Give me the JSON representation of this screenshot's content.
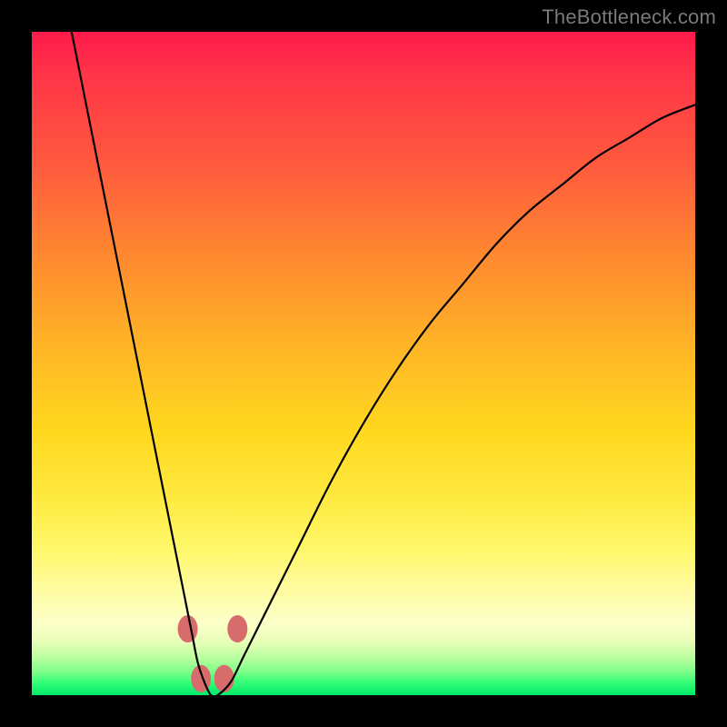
{
  "watermark": "TheBottleneck.com",
  "chart_data": {
    "type": "line",
    "title": "",
    "xlabel": "",
    "ylabel": "",
    "xlim": [
      0,
      100
    ],
    "ylim": [
      0,
      100
    ],
    "series": [
      {
        "name": "bottleneck-curve",
        "x": [
          6,
          8,
          10,
          12,
          14,
          16,
          18,
          20,
          22,
          24,
          25,
          26,
          27,
          28,
          30,
          32,
          35,
          40,
          45,
          50,
          55,
          60,
          65,
          70,
          75,
          80,
          85,
          90,
          95,
          100
        ],
        "y": [
          100,
          90,
          80,
          70,
          60,
          50,
          40,
          30,
          20,
          10,
          5,
          2,
          0,
          0,
          2,
          6,
          12,
          22,
          32,
          41,
          49,
          56,
          62,
          68,
          73,
          77,
          81,
          84,
          87,
          89
        ]
      }
    ],
    "markers": [
      {
        "name": "marker-left-upper",
        "x": 23.5,
        "y": 10
      },
      {
        "name": "marker-left-lower",
        "x": 25.5,
        "y": 2.5
      },
      {
        "name": "marker-right-lower",
        "x": 29,
        "y": 2.5
      },
      {
        "name": "marker-right-upper",
        "x": 31,
        "y": 10
      }
    ],
    "colors": {
      "curve": "#000000",
      "marker": "#d86b6b",
      "gradient_top": "#ff1a4b",
      "gradient_mid": "#ffd71e",
      "gradient_bottom": "#00e868"
    }
  }
}
